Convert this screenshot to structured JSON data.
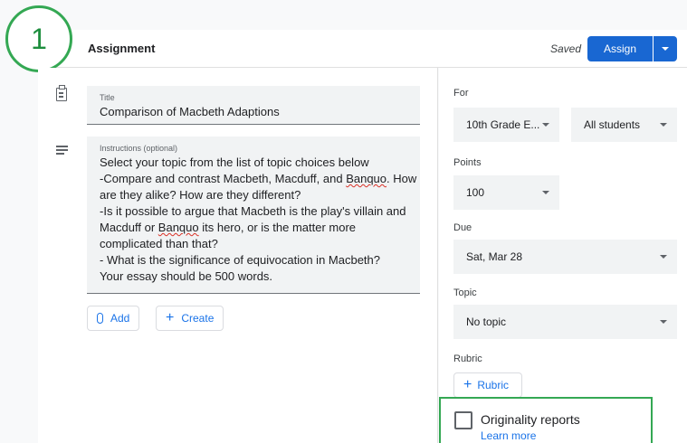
{
  "step_badge": "1",
  "header": {
    "title": "Assignment",
    "saved": "Saved",
    "assign_label": "Assign"
  },
  "form": {
    "title_label": "Title",
    "title_value": "Comparison of Macbeth Adaptions",
    "instructions_label": "Instructions (optional)",
    "instructions_lines": [
      "Select your topic from the list of topic choices below",
      "-Compare and contrast Macbeth, Macduff, and Banquo. How",
      "are they alike? How are they different?",
      "-Is it possible to argue that Macbeth is the play's villain and",
      "Macduff or Banquo its hero, or is the matter more",
      "complicated than that?",
      "- What is the significance of equivocation in Macbeth?",
      "Your essay should be 500 words."
    ],
    "add_label": "Add",
    "create_label": "Create"
  },
  "sidebar": {
    "for_label": "For",
    "class_value": "10th Grade E...",
    "students_value": "All students",
    "points_label": "Points",
    "points_value": "100",
    "due_label": "Due",
    "due_value": "Sat, Mar 28",
    "topic_label": "Topic",
    "topic_value": "No topic",
    "rubric_label": "Rubric",
    "rubric_button": "Rubric",
    "originality_label": "Originality reports",
    "learn_more": "Learn more"
  },
  "colors": {
    "accent": "#1967d2",
    "highlight": "#34a853",
    "link": "#1a73e8"
  }
}
